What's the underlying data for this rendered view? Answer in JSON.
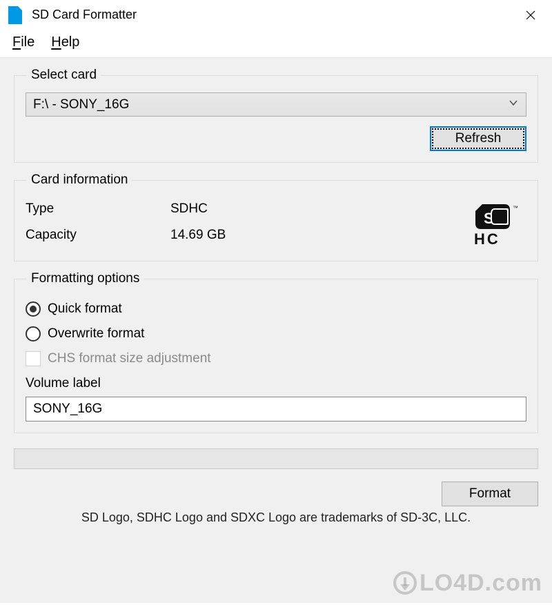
{
  "window": {
    "title": "SD Card Formatter"
  },
  "menu": {
    "file": "File",
    "help": "Help"
  },
  "select_card": {
    "legend": "Select card",
    "value": "F:\\ - SONY_16G",
    "refresh": "Refresh"
  },
  "card_info": {
    "legend": "Card information",
    "type_label": "Type",
    "type_value": "SDHC",
    "capacity_label": "Capacity",
    "capacity_value": "14.69 GB",
    "logo": "SDHC"
  },
  "formatting": {
    "legend": "Formatting options",
    "quick": "Quick format",
    "overwrite": "Overwrite format",
    "chs": "CHS format size adjustment",
    "selected": "quick",
    "chs_enabled": false,
    "volume_label_caption": "Volume label",
    "volume_label_value": "SONY_16G"
  },
  "actions": {
    "format": "Format"
  },
  "footer": {
    "trademark": "SD Logo, SDHC Logo and SDXC Logo are trademarks of SD-3C, LLC."
  },
  "watermark": "LO4D.com"
}
